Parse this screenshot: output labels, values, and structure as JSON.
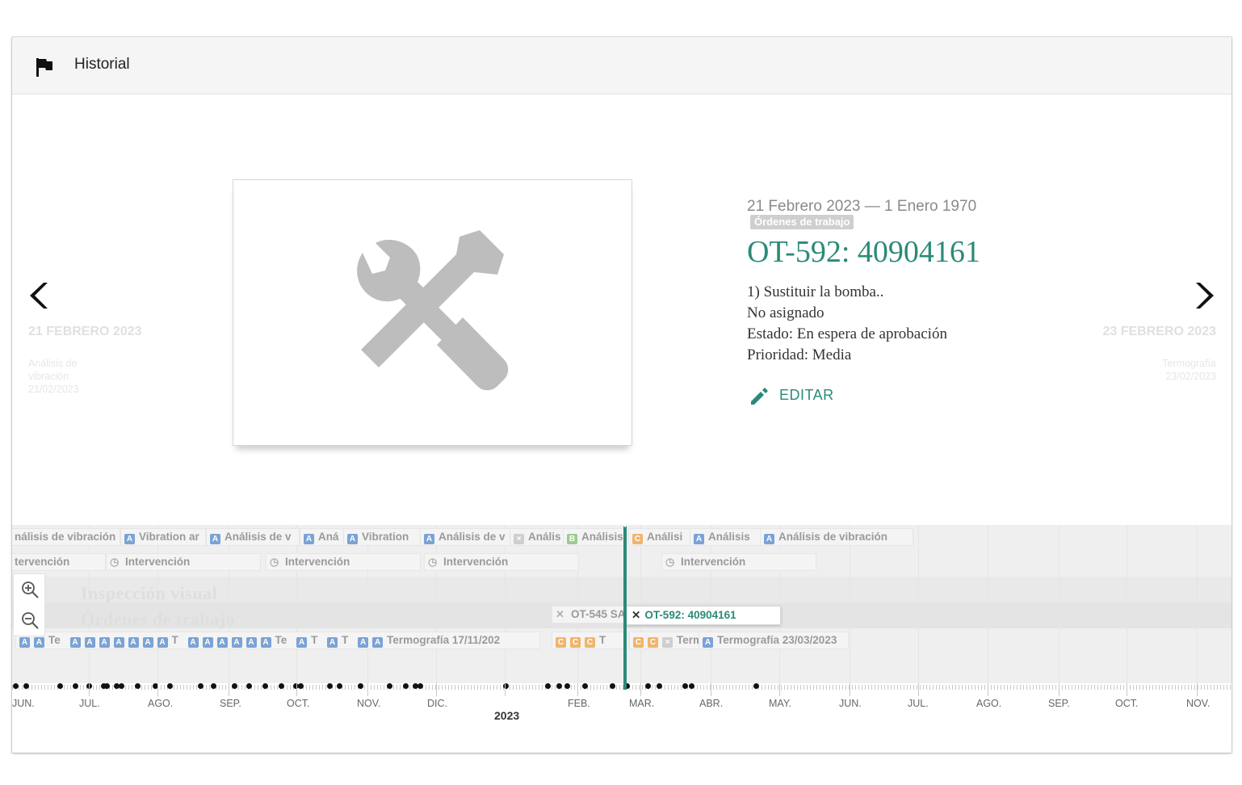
{
  "header": {
    "title": "Historial",
    "icon": "flag-icon"
  },
  "slide": {
    "prev": {
      "date": "21 FEBRERO 2023",
      "desc": "Análisis de vibración 21/02/2023"
    },
    "next": {
      "date": "23 FEBRERO 2023",
      "desc": "Termografía 23/02/2023"
    },
    "media_icon": "tools-icon",
    "dates": "21 Febrero 2023 — 1 Enero 1970",
    "category_badge": "Órdenes de trabajo",
    "title": "OT-592: 40904161",
    "lines": [
      "1) Sustituir la bomba..",
      "No asignado",
      "Estado: En espera de aprobación",
      "Prioridad: Media"
    ],
    "edit_label": "EDITAR"
  },
  "timeline": {
    "row1": [
      {
        "chip": "",
        "text": "nálisis de vibración"
      },
      {
        "chip": "A",
        "text": "Vibration ar"
      },
      {
        "chip": "A",
        "text": "Análisis de v"
      },
      {
        "chip": "A",
        "text": "Aná"
      },
      {
        "chip": "A",
        "text": "Vibration"
      },
      {
        "chip": "A",
        "text": "Análisis de v"
      },
      {
        "chip": "X",
        "text": "Anális"
      },
      {
        "chip": "B",
        "text": "Análisis"
      },
      {
        "chip": "C",
        "text": "Análisi"
      },
      {
        "chip": "A",
        "text": "Análisis"
      },
      {
        "chip": "A",
        "text": "Análisis de vibración"
      }
    ],
    "row2": [
      {
        "text": "tervención"
      },
      {
        "text": "Intervención"
      },
      {
        "text": "Intervención"
      },
      {
        "text": "Intervención"
      },
      {
        "text": "Intervención"
      }
    ],
    "groups": [
      "Inspección visual",
      "Órdenes de trabajo"
    ],
    "row4": [
      {
        "text": "OT-545 SA"
      }
    ],
    "selected": "OT-592: 40904161",
    "row5_labels": [
      "Te",
      "T",
      "Te",
      "T",
      "T",
      "Termografía 17/11/202",
      "T",
      "Term",
      "Termografía 23/03/2023"
    ],
    "chips_A": "A",
    "chips_C": "C",
    "months": [
      "JUN.",
      "JUL.",
      "AGO.",
      "SEP.",
      "OCT.",
      "NOV.",
      "DIC.",
      "FEB.",
      "MAR.",
      "ABR.",
      "MAY.",
      "JUN.",
      "JUL.",
      "AGO.",
      "SEP.",
      "OCT.",
      "NOV."
    ],
    "year": "2023"
  }
}
